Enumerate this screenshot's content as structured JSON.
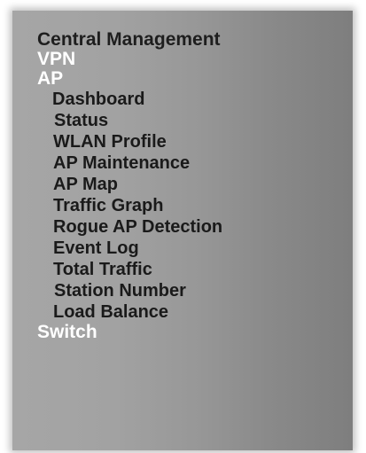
{
  "menu": {
    "central_management": "Central Management",
    "vpn": "VPN",
    "ap": "AP",
    "ap_items": [
      "Dashboard",
      "Status",
      "WLAN Profile",
      "AP Maintenance",
      "AP Map",
      "Traffic Graph",
      "Rogue AP Detection",
      "Event Log",
      "Total Traffic",
      "Station Number",
      "Load Balance"
    ],
    "switch": "Switch"
  },
  "colors": {
    "panel_light": "#a6a6a6",
    "panel_dark": "#7e7e7e",
    "section_dark_text": "#1e1e1e",
    "section_light_text": "#ffffff",
    "item_text": "#1a1a1a"
  }
}
